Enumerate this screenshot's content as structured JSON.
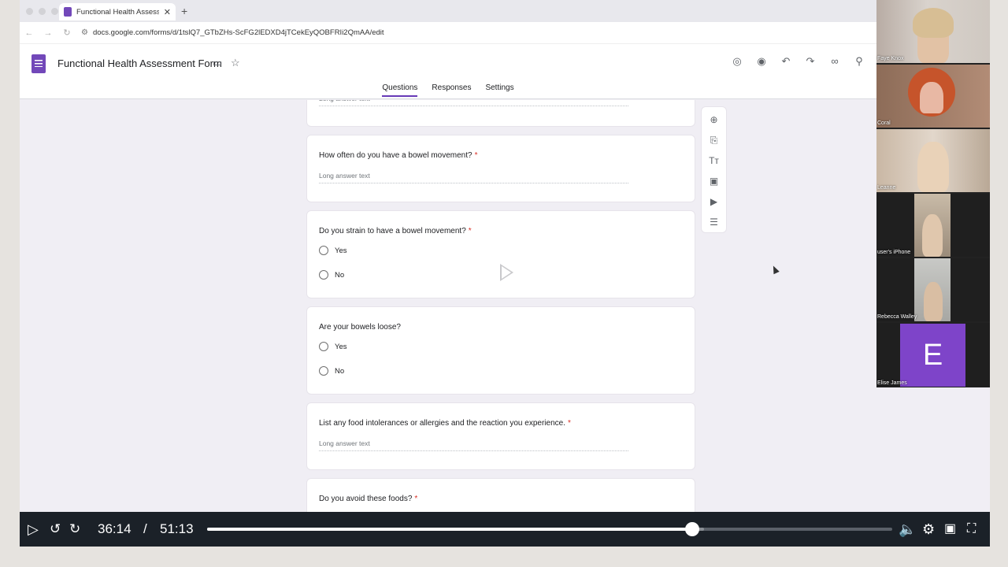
{
  "browser": {
    "tab_title": "Functional Health Assessment Form",
    "url": "docs.google.com/forms/d/1tslQ7_GTbZHs-ScFG2lEDXD4jTCekEyQOBFRIi2QmAA/edit"
  },
  "form_header": {
    "title": "Functional Health Assessment Form",
    "tabs": [
      "Questions",
      "Responses",
      "Settings"
    ],
    "active_tab": "Questions"
  },
  "questions": [
    {
      "title": "",
      "type": "long",
      "placeholder": "Long answer text"
    },
    {
      "title": "How often do you have a bowel movement?",
      "required": "*",
      "placeholder": "Long answer text"
    },
    {
      "title": "Do you strain to have a bowel movement?",
      "required": "*",
      "options": [
        "Yes",
        "No"
      ]
    },
    {
      "title": "Are your bowels loose?",
      "options": [
        "Yes",
        "No"
      ]
    },
    {
      "title": "List any food intolerances or allergies and the reaction you experience.",
      "required": "*",
      "placeholder": "Long answer text"
    },
    {
      "title": "Do you avoid these foods?",
      "required": "*"
    }
  ],
  "side_toolbar": [
    "add-question-icon",
    "import-questions-icon",
    "add-title-icon",
    "add-image-icon",
    "add-video-icon",
    "add-section-icon"
  ],
  "participants": [
    {
      "name": "Faye Knox"
    },
    {
      "name": "Coral"
    },
    {
      "name": "Leanne"
    },
    {
      "name": "user's iPhone"
    },
    {
      "name": "Rebecca Walley"
    },
    {
      "name": "Elise James",
      "initial": "E"
    }
  ],
  "player": {
    "current_time": "36:14",
    "separator": "/",
    "total_time": "51:13",
    "progress": 0.7075,
    "buffered": 0.725
  }
}
